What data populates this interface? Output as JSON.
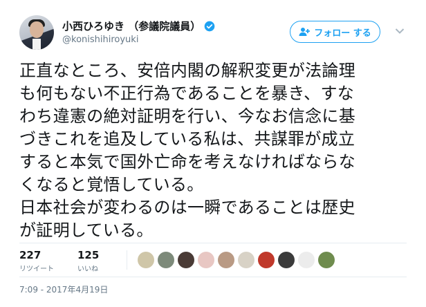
{
  "user": {
    "display_name": "小西ひろゆき （参議院議員）",
    "handle": "@konishihiroyuki"
  },
  "follow_button": {
    "label": "フォロー する"
  },
  "tweet": {
    "lines": [
      "正直なところ、安倍内閣の解釈変更が法論理",
      "も何もない不正行為であることを暴き、すな",
      "わち違憲の絶対証明を行い、今なお信念に基",
      "づきこれを追及している私は、共謀罪が成立",
      "すると本気で国外亡命を考えなければならな",
      "くなると覚悟している。",
      "日本社会が変わるのは一瞬であることは歴史",
      "が証明している。"
    ],
    "timestamp": "7:09 - 2017年4月19日"
  },
  "stats": {
    "retweets": {
      "count": "227",
      "label": "リツイート"
    },
    "likes": {
      "count": "125",
      "label": "いいね"
    }
  },
  "colors": {
    "accent": "#1da1f2",
    "text": "#14171a",
    "secondary": "#657786",
    "divider": "#e6ecf0"
  },
  "likers": [
    {
      "icon": "liker-avatar-1",
      "color": "#cfc6a8"
    },
    {
      "icon": "liker-avatar-2",
      "color": "#7d8a7a"
    },
    {
      "icon": "liker-avatar-3",
      "color": "#4a3b36"
    },
    {
      "icon": "liker-avatar-4",
      "color": "#e8c7c3"
    },
    {
      "icon": "liker-avatar-5",
      "color": "#b99a84"
    },
    {
      "icon": "liker-avatar-6",
      "color": "#d8d2c6"
    },
    {
      "icon": "liker-avatar-7",
      "color": "#c0392b"
    },
    {
      "icon": "liker-avatar-8",
      "color": "#3b3b3b"
    },
    {
      "icon": "liker-avatar-9",
      "color": "#ececec"
    },
    {
      "icon": "liker-avatar-10",
      "color": "#6f8c4e"
    }
  ]
}
